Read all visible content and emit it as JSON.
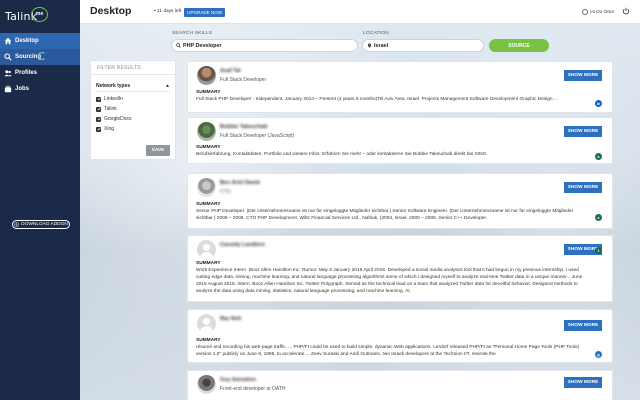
{
  "sidebar": {
    "logo_text": "Talink",
    "logo_badge": "me",
    "items": [
      {
        "label": "Desktop",
        "icon": "home-icon"
      },
      {
        "label": "Sourcing",
        "icon": "search-icon"
      },
      {
        "label": "Profiles",
        "icon": "users-icon"
      },
      {
        "label": "Jobs",
        "icon": "briefcase-icon"
      }
    ],
    "download_label": "DOWNLOAD ADDON"
  },
  "topbar": {
    "title": "Desktop",
    "trial": "• 11 days left",
    "upgrade_label": "UPGRADE NOW",
    "user": "Hi Oz Orez",
    "user_icon": "user-circle-icon",
    "power_icon": "power-icon"
  },
  "search": {
    "skills_label": "SEARCH SKILLS",
    "skills_value": "PHP Developer",
    "location_label": "LOCATION",
    "location_value": "Israel",
    "search_label": "SOURCE"
  },
  "filter": {
    "title": "FILTER RESULTS",
    "network_title": "Network types",
    "options": [
      {
        "label": "LinkedIn",
        "checked": true
      },
      {
        "label": "Talink",
        "checked": true
      },
      {
        "label": "GoogleDocs",
        "checked": true
      },
      {
        "label": "Xing",
        "checked": true
      }
    ],
    "save_label": "SAVE"
  },
  "results": [
    {
      "name": "Asaf Tal",
      "title": "Full Stack Developer",
      "title_blurred": false,
      "summary_label": "SUMMARY",
      "summary": "Full Stack PHP Developer · Independent, January 2014 – Present (4 years 5 months)Tel Aviv Area, Israel. Projects Management Software Development Graphic Design ...",
      "network": "LinkedIn",
      "network_color": "#0a66c2",
      "network_glyph": "in",
      "show_label": "SHOW MORE"
    },
    {
      "name": "Bobbie Takeuchab",
      "title": "Full Stack Developer (JavaScript)",
      "title_blurred": false,
      "summary_label": "SUMMARY",
      "summary": "Berufserfahrung, Kontaktdaten, Portfolio und weitere Infos: Erfahren Sie mehr – oder kontaktieren Sie Bobbie Takeuchab direkt bei XING.",
      "network": "Xing",
      "network_color": "#1e6b5a",
      "network_glyph": "x",
      "show_label": "SHOW MORE"
    },
    {
      "name": "Ben Ariel David",
      "title": "CTO",
      "title_blurred": true,
      "summary_label": "SUMMARY",
      "summary": "Senior PHP Developer. (Der Unternehmensname ist nur für eingeloggte Mitglieder sichtbar.) Senior Software Engineer. (Der Unternehmensname ist nur für eingeloggte Mitglieder sichtbar.) 2006 – 2008. CTO PHP Development. Wiltz Financial Services Ltd., Nahiok, (2004, Israel. 2000 – 2006. Senior C++ Developer.",
      "network": "Xing",
      "network_color": "#1e6b5a",
      "network_glyph": "x",
      "show_label": "SHOW MORE"
    },
    {
      "name": "Cassidy Landlore",
      "title": "",
      "title_blurred": false,
      "summary_label": "SUMMARY",
      "summary": "Work Experience Intern. Booz Allen Hamilton Inc. Rumor. May 8 January 2016 April 2016. Developed a social media analytics tool that it had begun in my previous internship. I used cutting edge data, mining, machine learning, and natural language processing algorithms some of which I designed myself to analyze real-time Twitter data in a unique manner... June 2015 August 2015. Intern. Booz Allen Hamilton Inc. Twitter Polygraph. Served as the technical lead on a team that analyzed Twitter data for deceitful behavior. Designed methods to analyze the data using data mining, statistics, natural language processing, and machine learning. AI.",
      "network": "Talink",
      "network_color": "#1e6b5a",
      "network_glyph": "t",
      "show_label": "SHOW MORE"
    },
    {
      "name": "Ifay Noh",
      "title": "",
      "title_blurred": false,
      "summary_label": "SUMMARY",
      "summary": "résumé and recording his web-page traffic. ... PHP/FI could be used to build simple, dynamic Web applications. Lerdorf released PHP/FI as \"Personal Home Page Tools (PHP Tools) version 1.0\" publicly on June 8, 1995, to accelerate ... Zeev Suraski and Andi Gutmans, two Israeli developers at the Technion IIT, rewrote the",
      "network": "GoogleDocs",
      "network_color": "#2d6fc0",
      "network_glyph": "g",
      "show_label": "SHOW MORE"
    },
    {
      "name": "Guy Amsalem",
      "title": "Front-end developer at OATH",
      "title_blurred": false,
      "summary_label": "SUMMARY",
      "summary": "",
      "network": "LinkedIn",
      "network_color": "#0a66c2",
      "network_glyph": "in",
      "show_label": "SHOW MORE"
    }
  ]
}
